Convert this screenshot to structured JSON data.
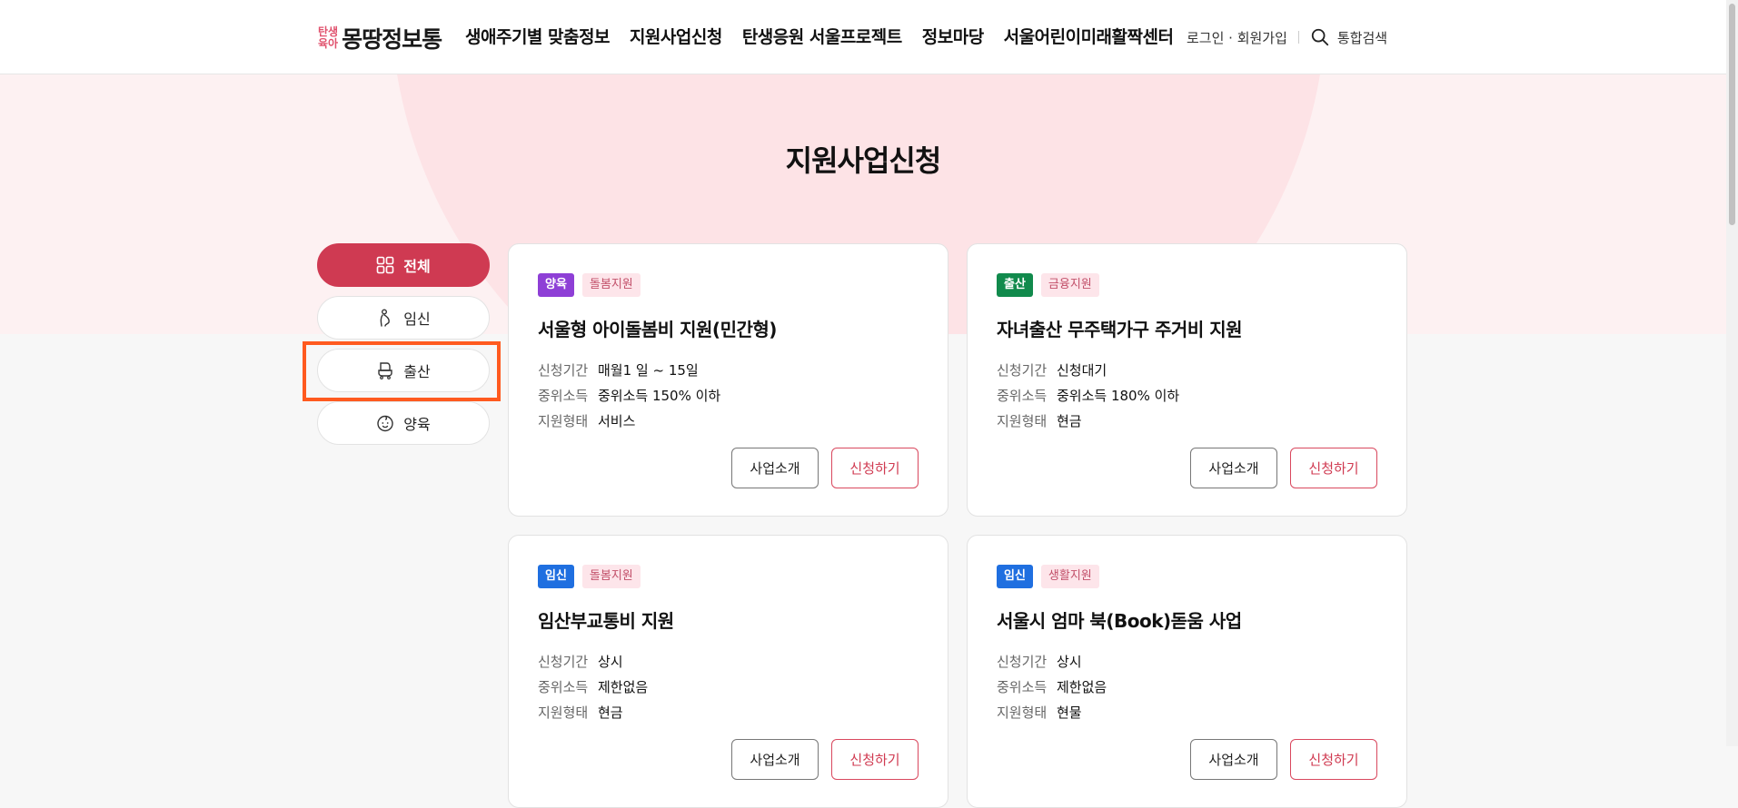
{
  "header": {
    "logo_sub_top": "탄생",
    "logo_sub_bottom": "육아",
    "logo_main_a": "몽땅",
    "logo_main_b": "정보통",
    "nav": [
      "생애주기별 맞춤정보",
      "지원사업신청",
      "탄생응원 서울프로젝트",
      "정보마당",
      "서울어린이미래활짝센터"
    ],
    "login": "로그인 · 회원가입",
    "search": "통합검색"
  },
  "page_title": "지원사업신청",
  "categories": [
    {
      "label": "전체",
      "icon": "grid-icon"
    },
    {
      "label": "임신",
      "icon": "pregnant-icon"
    },
    {
      "label": "출산",
      "icon": "stroller-icon"
    },
    {
      "label": "양육",
      "icon": "baby-face-icon"
    }
  ],
  "row_keys": {
    "period": "신청기간",
    "income": "중위소득",
    "type": "지원형태"
  },
  "buttons": {
    "intro": "사업소개",
    "apply": "신청하기"
  },
  "colors": {
    "양육": "#8e3fd6",
    "출산": "#118a4c",
    "임신": "#1f6fe0",
    "active": "#cf3a52",
    "highlight": "#ff5a1f"
  },
  "cards": [
    {
      "category": "양육",
      "sub": "돌봄지원",
      "title": "서울형 아이돌봄비 지원(민간형)",
      "period": "매월1 일 ~ 15일",
      "income": "중위소득 150% 이하",
      "type": "서비스"
    },
    {
      "category": "출산",
      "sub": "금융지원",
      "title": "자녀출산 무주택가구 주거비 지원",
      "period": "신청대기",
      "income": "중위소득 180% 이하",
      "type": "현금"
    },
    {
      "category": "임신",
      "sub": "돌봄지원",
      "title": "임산부교통비 지원",
      "period": "상시",
      "income": "제한없음",
      "type": "현금"
    },
    {
      "category": "임신",
      "sub": "생활지원",
      "title": "서울시 엄마 북(Book)돋움 사업",
      "period": "상시",
      "income": "제한없음",
      "type": "현물"
    }
  ]
}
